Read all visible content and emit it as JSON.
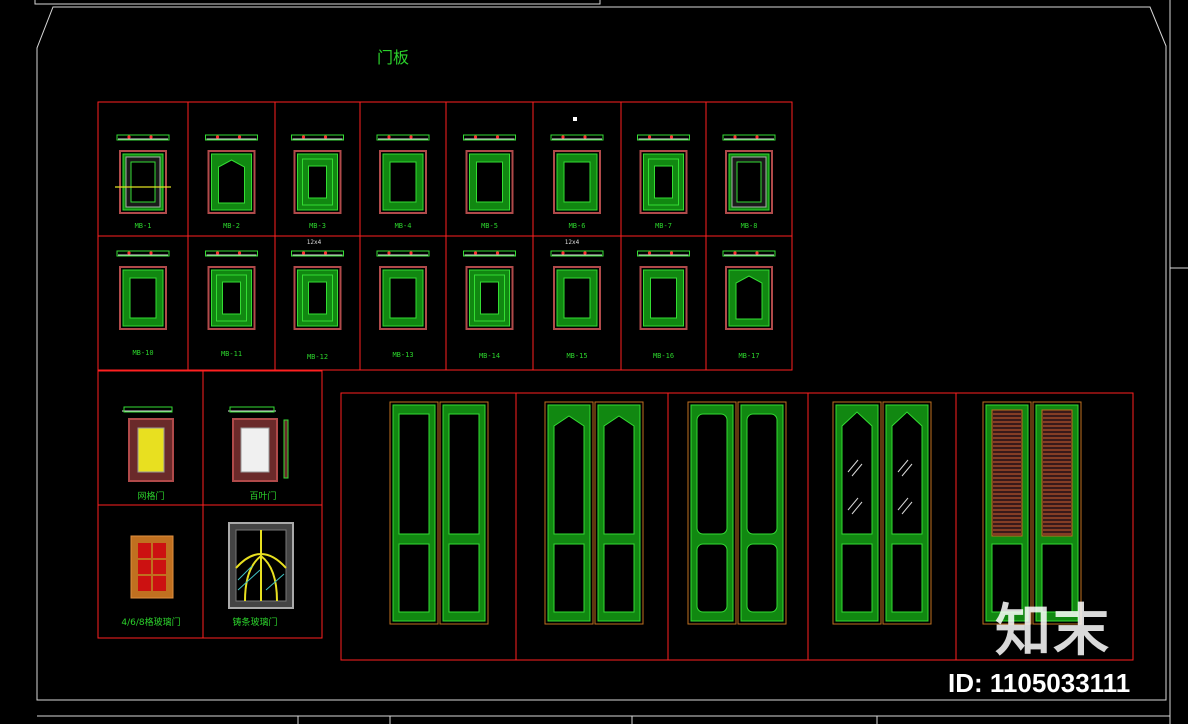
{
  "title": "门板",
  "panels_row1": [
    "MB-1",
    "MB-2",
    "MB-3",
    "MB-4",
    "MB-5",
    "MB-6",
    "MB-7",
    "MB-8"
  ],
  "panels_row2": [
    "MB-10",
    "MB-11",
    "MB-12",
    "MB-13",
    "MB-14",
    "MB-15",
    "MB-16",
    "MB-17"
  ],
  "mini_marks": {
    "r2c3": "12x4",
    "r2c6": "12x4"
  },
  "special_doors": {
    "mesh": "网格门",
    "louver": "百叶门",
    "grid_glass": "4/6/8格玻璃门",
    "lattice_glass": "铸条玻璃门"
  },
  "watermark": {
    "logo": "知末",
    "id": "ID: 1105033111"
  },
  "colors": {
    "background": "#000000",
    "frame": "#ff2020",
    "door_fill": "#118811",
    "door_line": "#33dd33",
    "outer_border": "#b04a4a",
    "label": "#2bd12b",
    "white_line": "#dddddd"
  }
}
